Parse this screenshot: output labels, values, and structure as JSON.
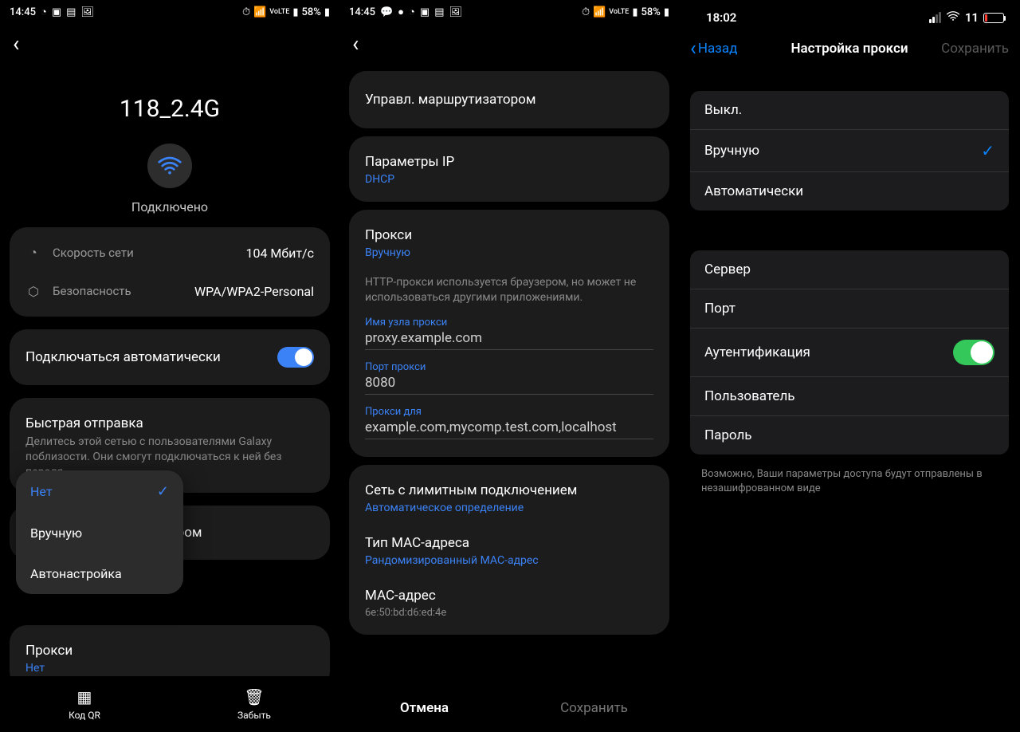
{
  "screen1": {
    "status": {
      "time": "14:45",
      "battery": "58%"
    },
    "network_name": "118_2.4G",
    "connected": "Подключено",
    "speed_label": "Скорость сети",
    "speed_value": "104 Мбит/с",
    "security_label": "Безопасность",
    "security_value": "WPA/WPA2-Personal",
    "auto_connect": "Подключаться автоматически",
    "quick_share_title": "Быстрая отправка",
    "quick_share_desc": "Делитесь этой сетью с пользователями Galaxy поблизости. Они смогут подключаться к ней без пароля.",
    "router_mgmt_partial": "ором",
    "popup": {
      "opt1": "Нет",
      "opt2": "Вручную",
      "opt3": "Автонастройка"
    },
    "proxy_title": "Прокси",
    "proxy_value": "Нет",
    "bottom": {
      "qr": "Код QR",
      "forget": "Забыть"
    }
  },
  "screen2": {
    "status": {
      "time": "14:45",
      "battery": "58%"
    },
    "router_mgmt": "Управл. маршрутизатором",
    "ip_params": "Параметры IP",
    "ip_value": "DHCP",
    "proxy_title": "Прокси",
    "proxy_mode": "Вручную",
    "proxy_note": "HTTP-прокси используется браузером, но может не использоваться другими приложениями.",
    "host_label": "Имя узла прокси",
    "host_value": "proxy.example.com",
    "port_label": "Порт прокси",
    "port_value": "8080",
    "bypass_label": "Прокси для",
    "bypass_value": "example.com,mycomp.test.com,localhost",
    "metered_title": "Сеть с лимитным подключением",
    "metered_value": "Автоматическое определение",
    "mac_type_title": "Тип MAC-адреса",
    "mac_type_value": "Рандомизированный MAC-адрес",
    "mac_addr_title": "MAC-адрес",
    "mac_addr_value": "6e:50:bd:d6:ed:4e",
    "cancel": "Отмена",
    "save": "Сохранить"
  },
  "screen3": {
    "status": {
      "time": "18:02",
      "battery": "11"
    },
    "back": "Назад",
    "title": "Настройка прокси",
    "save": "Сохранить",
    "mode": {
      "off": "Выкл.",
      "manual": "Вручную",
      "auto": "Автоматически"
    },
    "fields": {
      "server": "Сервер",
      "port": "Порт",
      "auth": "Аутентификация",
      "user": "Пользователь",
      "pass": "Пароль"
    },
    "footer": "Возможно, Ваши параметры доступа будут отправлены в незашифрованном виде"
  }
}
